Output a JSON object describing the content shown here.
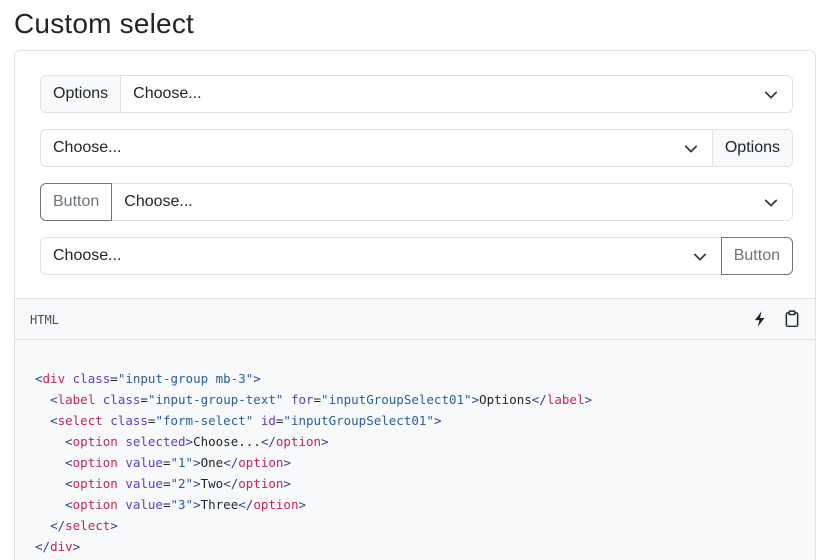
{
  "page": {
    "title": "Custom select"
  },
  "rows": [
    {
      "addon_label": "Options",
      "select_value": "Choose..."
    },
    {
      "addon_label": "Options",
      "select_value": "Choose..."
    },
    {
      "button_label": "Button",
      "select_value": "Choose..."
    },
    {
      "button_label": "Button",
      "select_value": "Choose..."
    }
  ],
  "code": {
    "language": "HTML",
    "icons": {
      "stackblitz": "lightning-icon",
      "copy": "clipboard-icon"
    },
    "lines": [
      {
        "indent": "",
        "parts": [
          {
            "t": "tag",
            "v": "<"
          },
          {
            "t": "name",
            "v": "div"
          },
          {
            "t": "text",
            "v": " "
          },
          {
            "t": "attr",
            "v": "class"
          },
          {
            "t": "text",
            "v": "="
          },
          {
            "t": "val",
            "v": "\"input-group mb-3\""
          },
          {
            "t": "tag",
            "v": ">"
          }
        ]
      },
      {
        "indent": "  ",
        "parts": [
          {
            "t": "tag",
            "v": "<"
          },
          {
            "t": "name",
            "v": "label"
          },
          {
            "t": "text",
            "v": " "
          },
          {
            "t": "attr",
            "v": "class"
          },
          {
            "t": "text",
            "v": "="
          },
          {
            "t": "val",
            "v": "\"input-group-text\""
          },
          {
            "t": "text",
            "v": " "
          },
          {
            "t": "attr",
            "v": "for"
          },
          {
            "t": "text",
            "v": "="
          },
          {
            "t": "val",
            "v": "\"inputGroupSelect01\""
          },
          {
            "t": "tag",
            "v": ">"
          },
          {
            "t": "text",
            "v": "Options"
          },
          {
            "t": "tag",
            "v": "</"
          },
          {
            "t": "name",
            "v": "label"
          },
          {
            "t": "tag",
            "v": ">"
          }
        ]
      },
      {
        "indent": "  ",
        "parts": [
          {
            "t": "tag",
            "v": "<"
          },
          {
            "t": "name",
            "v": "select"
          },
          {
            "t": "text",
            "v": " "
          },
          {
            "t": "attr",
            "v": "class"
          },
          {
            "t": "text",
            "v": "="
          },
          {
            "t": "val",
            "v": "\"form-select\""
          },
          {
            "t": "text",
            "v": " "
          },
          {
            "t": "attr",
            "v": "id"
          },
          {
            "t": "text",
            "v": "="
          },
          {
            "t": "val",
            "v": "\"inputGroupSelect01\""
          },
          {
            "t": "tag",
            "v": ">"
          }
        ]
      },
      {
        "indent": "    ",
        "parts": [
          {
            "t": "tag",
            "v": "<"
          },
          {
            "t": "name",
            "v": "option"
          },
          {
            "t": "text",
            "v": " "
          },
          {
            "t": "attr",
            "v": "selected"
          },
          {
            "t": "tag",
            "v": ">"
          },
          {
            "t": "text",
            "v": "Choose..."
          },
          {
            "t": "tag",
            "v": "</"
          },
          {
            "t": "name",
            "v": "option"
          },
          {
            "t": "tag",
            "v": ">"
          }
        ]
      },
      {
        "indent": "    ",
        "parts": [
          {
            "t": "tag",
            "v": "<"
          },
          {
            "t": "name",
            "v": "option"
          },
          {
            "t": "text",
            "v": " "
          },
          {
            "t": "attr",
            "v": "value"
          },
          {
            "t": "text",
            "v": "="
          },
          {
            "t": "val",
            "v": "\"1\""
          },
          {
            "t": "tag",
            "v": ">"
          },
          {
            "t": "text",
            "v": "One"
          },
          {
            "t": "tag",
            "v": "</"
          },
          {
            "t": "name",
            "v": "option"
          },
          {
            "t": "tag",
            "v": ">"
          }
        ]
      },
      {
        "indent": "    ",
        "parts": [
          {
            "t": "tag",
            "v": "<"
          },
          {
            "t": "name",
            "v": "option"
          },
          {
            "t": "text",
            "v": " "
          },
          {
            "t": "attr",
            "v": "value"
          },
          {
            "t": "text",
            "v": "="
          },
          {
            "t": "val",
            "v": "\"2\""
          },
          {
            "t": "tag",
            "v": ">"
          },
          {
            "t": "text",
            "v": "Two"
          },
          {
            "t": "tag",
            "v": "</"
          },
          {
            "t": "name",
            "v": "option"
          },
          {
            "t": "tag",
            "v": ">"
          }
        ]
      },
      {
        "indent": "    ",
        "parts": [
          {
            "t": "tag",
            "v": "<"
          },
          {
            "t": "name",
            "v": "option"
          },
          {
            "t": "text",
            "v": " "
          },
          {
            "t": "attr",
            "v": "value"
          },
          {
            "t": "text",
            "v": "="
          },
          {
            "t": "val",
            "v": "\"3\""
          },
          {
            "t": "tag",
            "v": ">"
          },
          {
            "t": "text",
            "v": "Three"
          },
          {
            "t": "tag",
            "v": "</"
          },
          {
            "t": "name",
            "v": "option"
          },
          {
            "t": "tag",
            "v": ">"
          }
        ]
      },
      {
        "indent": "  ",
        "parts": [
          {
            "t": "tag",
            "v": "</"
          },
          {
            "t": "name",
            "v": "select"
          },
          {
            "t": "tag",
            "v": ">"
          }
        ]
      },
      {
        "indent": "",
        "parts": [
          {
            "t": "tag",
            "v": "</"
          },
          {
            "t": "name",
            "v": "div"
          },
          {
            "t": "tag",
            "v": ">"
          }
        ]
      }
    ]
  },
  "colors": {
    "border": "#dee2e6",
    "addon_bg": "#f8f9fa",
    "button_outline": "#6c757d",
    "code_bg": "#f8f9fa"
  }
}
